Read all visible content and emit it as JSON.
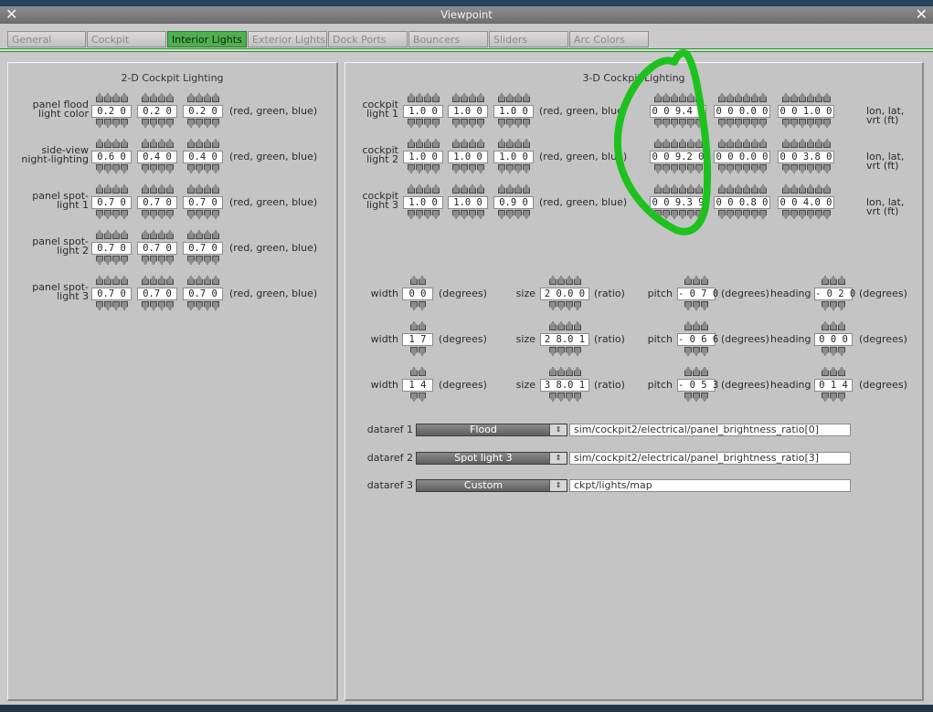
{
  "window": {
    "title": "Viewpoint",
    "close_glyph": "✕"
  },
  "tabs": [
    {
      "label": "General",
      "active": false
    },
    {
      "label": "Cockpit",
      "active": false
    },
    {
      "label": "Interior Lights",
      "active": true
    },
    {
      "label": "Exterior Lights",
      "active": false
    },
    {
      "label": "Dock Ports",
      "active": false
    },
    {
      "label": "Bouncers",
      "active": false
    },
    {
      "label": "Sliders",
      "active": false
    },
    {
      "label": "Arc Colors",
      "active": false
    }
  ],
  "left": {
    "title": "2-D Cockpit Lighting",
    "units": "(red, green, blue)",
    "rows": [
      {
        "line1": "panel flood",
        "line2": "light color",
        "values": [
          "0.2 0",
          "0.2 0",
          "0.2 0"
        ]
      },
      {
        "line1": "side-view",
        "line2": "night-lighting",
        "values": [
          "0.6 0",
          "0.4 0",
          "0.4 0"
        ]
      },
      {
        "line1": "panel spot-",
        "line2": "light 1",
        "values": [
          "0.7 0",
          "0.7 0",
          "0.7 0"
        ]
      },
      {
        "line1": "panel spot-",
        "line2": "light 2",
        "values": [
          "0.7 0",
          "0.7 0",
          "0.7 0"
        ]
      },
      {
        "line1": "panel spot-",
        "line2": "light 3",
        "values": [
          "0.7 0",
          "0.7 0",
          "0.7 0"
        ]
      }
    ]
  },
  "right": {
    "title": "3-D Cockpit Lighting",
    "color_units": "(red, green, blue)",
    "pos_units": "lon, lat, vrt (ft)",
    "lights": [
      {
        "line1": "cockpit",
        "line2": "light 1",
        "colors": [
          "1.0 0",
          "1.0 0",
          "1.0 0"
        ],
        "pos": [
          "0 0 9.4 9",
          "0 0 0.0 0",
          "0 0 1.0 0"
        ]
      },
      {
        "line1": "cockpit",
        "line2": "light 2",
        "colors": [
          "1.0 0",
          "1.0 0",
          "1.0 0"
        ],
        "pos": [
          "0 0 9.2 0",
          "0 0 0.0 0",
          "0 0 3.8 0"
        ]
      },
      {
        "line1": "cockpit",
        "line2": "light 3",
        "colors": [
          "1.0 0",
          "1.0 0",
          "0.9 0"
        ],
        "pos": [
          "0 0 9.3 9",
          "0 0 0.8 0",
          "0 0 4.0 0"
        ]
      }
    ],
    "beam_labels": {
      "width": "width",
      "size": "size",
      "pitch": "pitch",
      "heading": "heading",
      "degrees": "(degrees)",
      "ratio": "(ratio)"
    },
    "beams": [
      {
        "width": "0 0",
        "size": "2 0.0 0",
        "pitch": "- 0 7 0",
        "heading": "- 0 2 0"
      },
      {
        "width": "1 7",
        "size": "2 8.0 1",
        "pitch": "- 0 6 6",
        "heading": "0 0 0"
      },
      {
        "width": "1 4",
        "size": "3 8.0 1",
        "pitch": "- 0 5 3",
        "heading": "0 1 4"
      }
    ],
    "datarefs": [
      {
        "label": "dataref 1",
        "select": "Flood",
        "path": "sim/cockpit2/electrical/panel_brightness_ratio[0]"
      },
      {
        "label": "dataref 2",
        "select": "Spot light 3",
        "path": "sim/cockpit2/electrical/panel_brightness_ratio[3]"
      },
      {
        "label": "dataref 3",
        "select": "Custom",
        "path": "ckpt/lights/map"
      }
    ],
    "dropdown_glyph": "⇕"
  },
  "colors": {
    "accent": "#4db24d",
    "annotation": "#1ec21e"
  }
}
